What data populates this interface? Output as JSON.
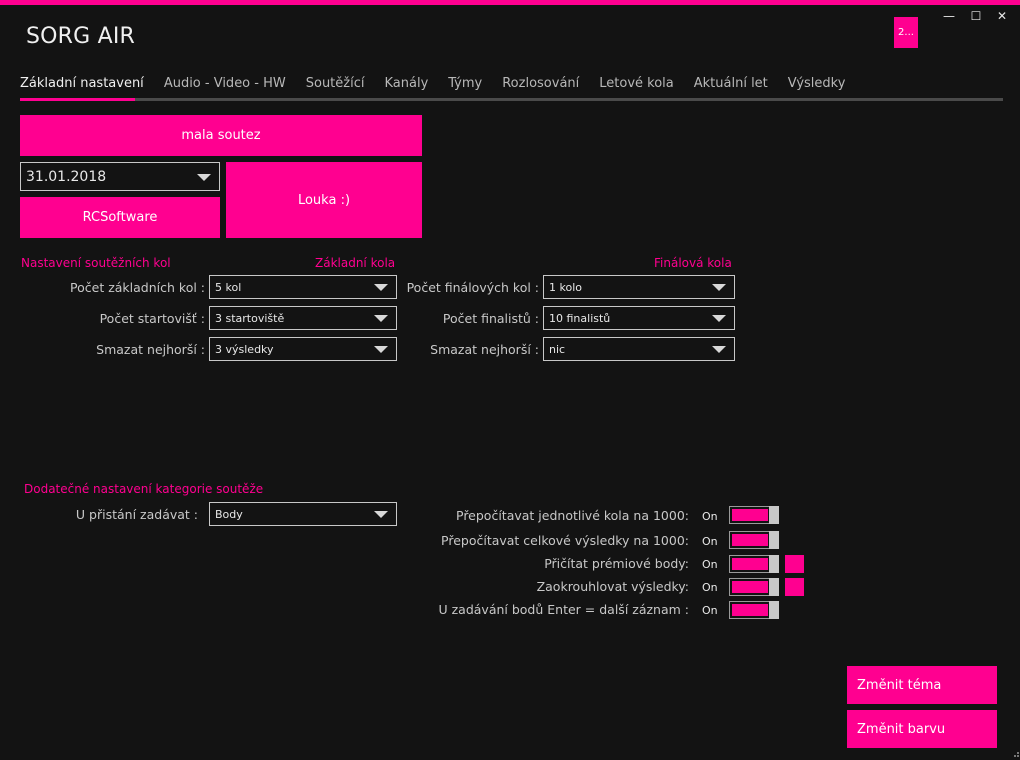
{
  "app": {
    "title": "SORG AIR",
    "badge": "2..."
  },
  "window": {
    "minimize": "—",
    "maximize": "☐",
    "close": "✕"
  },
  "tabs": [
    "Základní nastavení",
    "Audio - Video - HW",
    "Soutěžící",
    "Kanály",
    "Týmy",
    "Rozlosování",
    "Letové kola",
    "Aktuální let",
    "Výsledky"
  ],
  "competition": {
    "name": "mala soutez",
    "date": "31.01.2018",
    "organizer": "RCSoftware",
    "location": "Louka :)"
  },
  "rounds": {
    "section_title": "Nastavení soutěžních kol",
    "basic_title": "Základní kola",
    "final_title": "Finálová kola",
    "basic": [
      {
        "label": "Počet základních kol :",
        "value": "5 kol"
      },
      {
        "label": "Počet startovišť :",
        "value": "3 startoviště"
      },
      {
        "label": "Smazat nejhorší :",
        "value": "3 výsledky"
      }
    ],
    "final": [
      {
        "label": "Počet finálových kol :",
        "value": "1 kolo"
      },
      {
        "label": "Počet finalistů :",
        "value": "10 finalistů"
      },
      {
        "label": "Smazat nejhorší :",
        "value": "nic"
      }
    ]
  },
  "extra": {
    "section_title": "Dodatečné nastavení kategorie soutěže",
    "landing_label": "U přistání zadávat :",
    "landing_value": "Body",
    "toggles": [
      {
        "label": "Přepočítavat jednotlivé kola na 1000:",
        "state": "On",
        "has_extra": false
      },
      {
        "label": "Přepočítavat celkové výsledky na 1000:",
        "state": "On",
        "has_extra": false
      },
      {
        "label": "Přičítat prémiové body:",
        "state": "On",
        "has_extra": true
      },
      {
        "label": "Zaokrouhlovat výsledky:",
        "state": "On",
        "has_extra": true
      },
      {
        "label": "U zadávání bodů Enter = další záznam :",
        "state": "On",
        "has_extra": false
      }
    ]
  },
  "actions": {
    "change_theme": "Změnit téma",
    "change_color": "Změnit barvu"
  },
  "colors": {
    "accent": "#ff0090",
    "background": "#131313",
    "text": "#cfcfcf"
  }
}
